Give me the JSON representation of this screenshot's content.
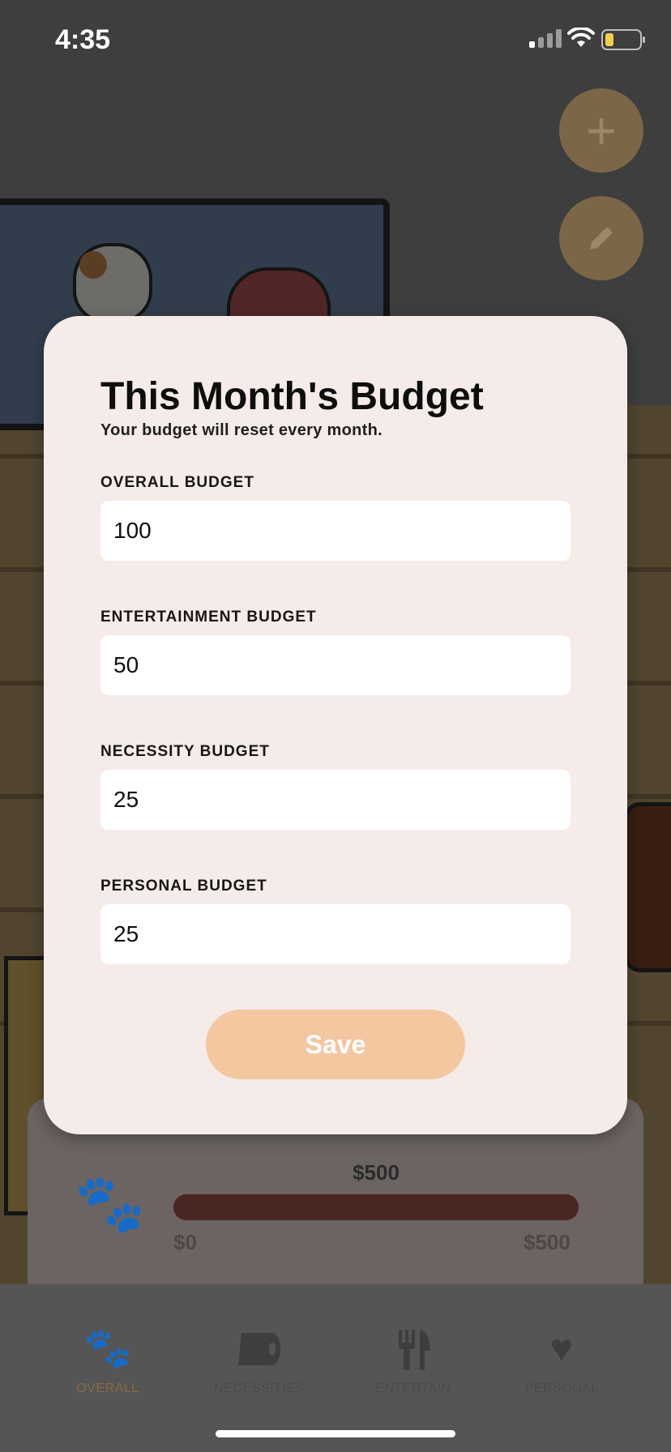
{
  "status_bar": {
    "time": "4:35"
  },
  "modal": {
    "title": "This Month's Budget",
    "subtitle": "Your budget will reset every month.",
    "fields": [
      {
        "label": "OVERALL BUDGET",
        "value": "100"
      },
      {
        "label": "ENTERTAINMENT BUDGET",
        "value": "50"
      },
      {
        "label": "NECESSITY BUDGET",
        "value": "25"
      },
      {
        "label": "PERSONAL BUDGET",
        "value": "25"
      }
    ],
    "save_label": "Save"
  },
  "fabs": {
    "add_symbol": "+",
    "add_icon": "plus-icon",
    "edit_icon": "pencil-icon"
  },
  "overview": {
    "amount": "$500",
    "min_label": "$0",
    "max_label": "$500",
    "progress": 1.0,
    "icon": "paw-icon"
  },
  "tabs": [
    {
      "label": "OVERALL",
      "icon": "paw-icon",
      "active": true
    },
    {
      "label": "NECESSITIES",
      "icon": "toilet-paper-icon",
      "active": false
    },
    {
      "label": "ENTERTAIN",
      "icon": "utensils-icon",
      "active": false
    },
    {
      "label": "PERSONAL",
      "icon": "heart-icon",
      "active": false
    }
  ],
  "colors": {
    "modal_bg": "#f5ebe8",
    "save_button": "#f3c7a0",
    "progress_bar": "#4a2623",
    "active_tab": "#8a6a44"
  }
}
